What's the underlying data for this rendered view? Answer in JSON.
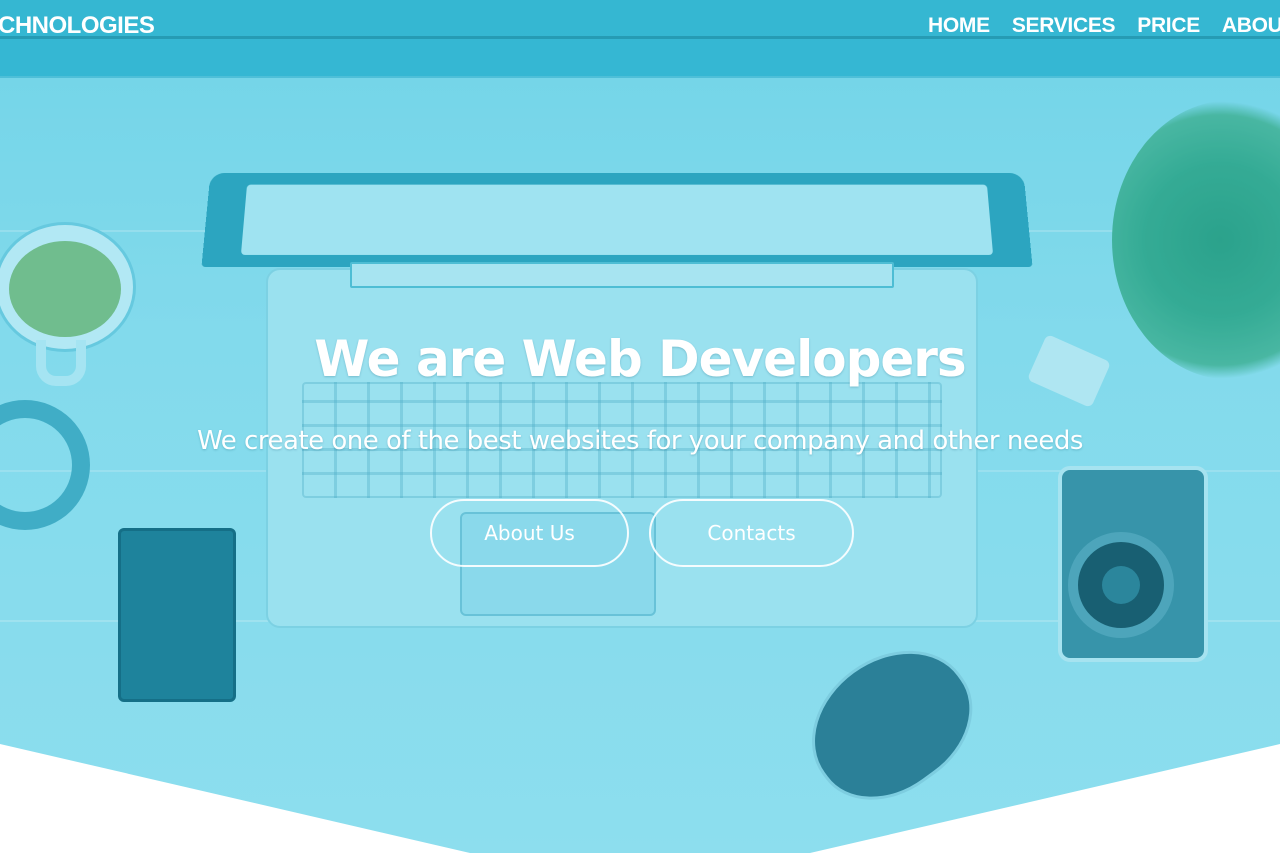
{
  "header": {
    "brand": "CHNOLOGIES",
    "nav": [
      "HOME",
      "SERVICES",
      "PRICE",
      "ABOUT"
    ]
  },
  "hero": {
    "title": "We are Web Developers",
    "subtitle": "We create one of the best websites for your company and other needs",
    "buttons": {
      "about": "About Us",
      "contacts": "Contacts"
    }
  },
  "colors": {
    "accent": "#2ab2ce",
    "text": "#ffffff",
    "background": "#ffffff"
  }
}
